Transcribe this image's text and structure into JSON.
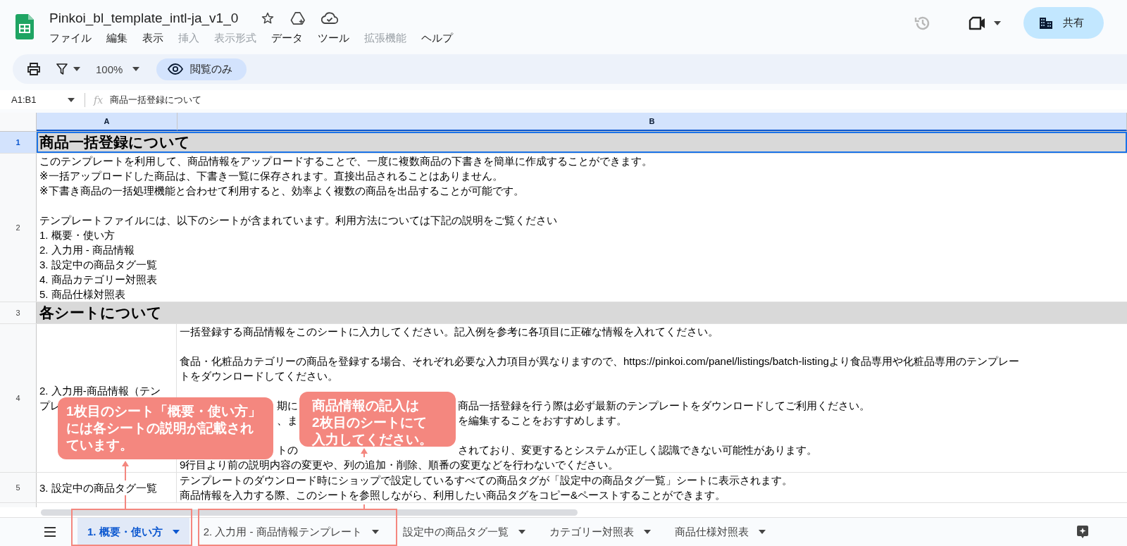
{
  "app": {
    "title": "Pinkoi_bl_template_intl-ja_v1_0"
  },
  "menu": [
    {
      "label": "ファイル",
      "disabled": false
    },
    {
      "label": "編集",
      "disabled": false
    },
    {
      "label": "表示",
      "disabled": false
    },
    {
      "label": "挿入",
      "disabled": true
    },
    {
      "label": "表示形式",
      "disabled": true
    },
    {
      "label": "データ",
      "disabled": false
    },
    {
      "label": "ツール",
      "disabled": false
    },
    {
      "label": "拡張機能",
      "disabled": true
    },
    {
      "label": "ヘルプ",
      "disabled": false
    }
  ],
  "share_button": "共有",
  "toolbar": {
    "zoom": "100%",
    "view_only": "閲覧のみ"
  },
  "formula_bar": {
    "cell_ref": "A1:B1",
    "fx": "fx",
    "value": "商品一括登録について"
  },
  "columns": [
    {
      "label": "A",
      "selected": true
    },
    {
      "label": "B",
      "selected": true
    }
  ],
  "rows": [
    {
      "number": "1",
      "selected": true,
      "kind": "heading",
      "text": "商品一括登録について"
    },
    {
      "number": "2",
      "selected": false,
      "kind": "note",
      "lines": [
        {
          "kind": "text",
          "text": "このテンプレートを利用して、商品情報をアップロードすることで、一度に複数商品の下書きを簡単に作成することができます。"
        },
        {
          "kind": "text",
          "text": "※一括アップロードした商品は、下書き一覧に保存されます。直接出品されることはありません。"
        },
        {
          "kind": "text",
          "text": "※下書き商品の一括処理機能と合わせて利用すると、効率よく複数の商品を出品することが可能です。"
        },
        {
          "kind": "blank"
        },
        {
          "kind": "text",
          "text": "テンプレートファイルには、以下のシートが含まれています。利用方法については下記の説明をご覧ください"
        },
        {
          "kind": "text",
          "text": "1. 概要・使い方"
        },
        {
          "kind": "text",
          "text": "2. 入力用 - 商品情報"
        },
        {
          "kind": "text",
          "text": "3. 設定中の商品タグ一覧"
        },
        {
          "kind": "text",
          "text": "4. 商品カテゴリー対照表"
        },
        {
          "kind": "text",
          "text": "5. 商品仕様対照表"
        }
      ]
    },
    {
      "number": "3",
      "selected": false,
      "kind": "heading",
      "text": "各シートについて"
    },
    {
      "number": "4",
      "selected": false,
      "kind": "pair",
      "cells": [
        {
          "lines": [
            {
              "kind": "text",
              "text": "2. 入力用-商品情報（テン"
            },
            {
              "kind": "text",
              "text": "プレ"
            }
          ]
        },
        {
          "lines": [
            {
              "kind": "text",
              "text": "一括登録する商品情報をこのシートに入力してください。記入例を参考に各項目に正確な情報を入れてください。"
            },
            {
              "kind": "blank"
            },
            {
              "kind": "text",
              "text": "食品・化粧品カテゴリーの商品を登録する場合、それぞれ必要な入力項目が異なりますので、https://pinkoi.com/panel/listings/batch-listingより食品専用や化粧品専用のテンプレー"
            },
            {
              "kind": "text",
              "text": "トをダウンロードしてください。"
            },
            {
              "kind": "blank"
            },
            {
              "kind": "split",
              "mid": "期に",
              "after": "商品一括登録を行う際は必ず最新のテンプレートをダウンロードしてご利用ください。"
            },
            {
              "kind": "split",
              "mid": "、ま",
              "after": "を編集することをおすすめします。"
            },
            {
              "kind": "blank"
            },
            {
              "kind": "split",
              "mid": "トの",
              "after": "されており、変更するとシステムが正しく認識できない可能性があります。"
            },
            {
              "kind": "text",
              "text": "9行目より前の説明内容の変更や、列の追加・削除、順番の変更などを行わないでください。"
            }
          ]
        }
      ]
    },
    {
      "number": "5",
      "selected": false,
      "kind": "pair",
      "cells": [
        {
          "lines": [
            {
              "kind": "text",
              "text": "3. 設定中の商品タグ一覧"
            }
          ]
        },
        {
          "lines": [
            {
              "kind": "text",
              "text": "テンプレートのダウンロード時にショップで設定しているすべての商品タグが「設定中の商品タグ一覧」シートに表示されます。"
            },
            {
              "kind": "text",
              "text": "商品情報を入力する際、このシートを参照しながら、利用したい商品タグをコピー&ペーストすることができます。"
            }
          ]
        }
      ]
    }
  ],
  "sheet_tabs": [
    {
      "label": "1. 概要・使い方",
      "selected": true
    },
    {
      "label": "2. 入力用 - 商品情報テンプレート",
      "selected": false
    },
    {
      "label": "設定中の商品タグ一覧",
      "selected": false
    },
    {
      "label": "カテゴリー対照表",
      "selected": false
    },
    {
      "label": "商品仕様対照表",
      "selected": false
    }
  ],
  "callouts": [
    {
      "lines": [
        "1枚目のシート「概要・使い方」",
        "には各シートの説明が記載され",
        "ています。"
      ]
    },
    {
      "lines": [
        "商品情報の記入は",
        "2枚目のシートにて",
        "入力してください。"
      ]
    }
  ]
}
